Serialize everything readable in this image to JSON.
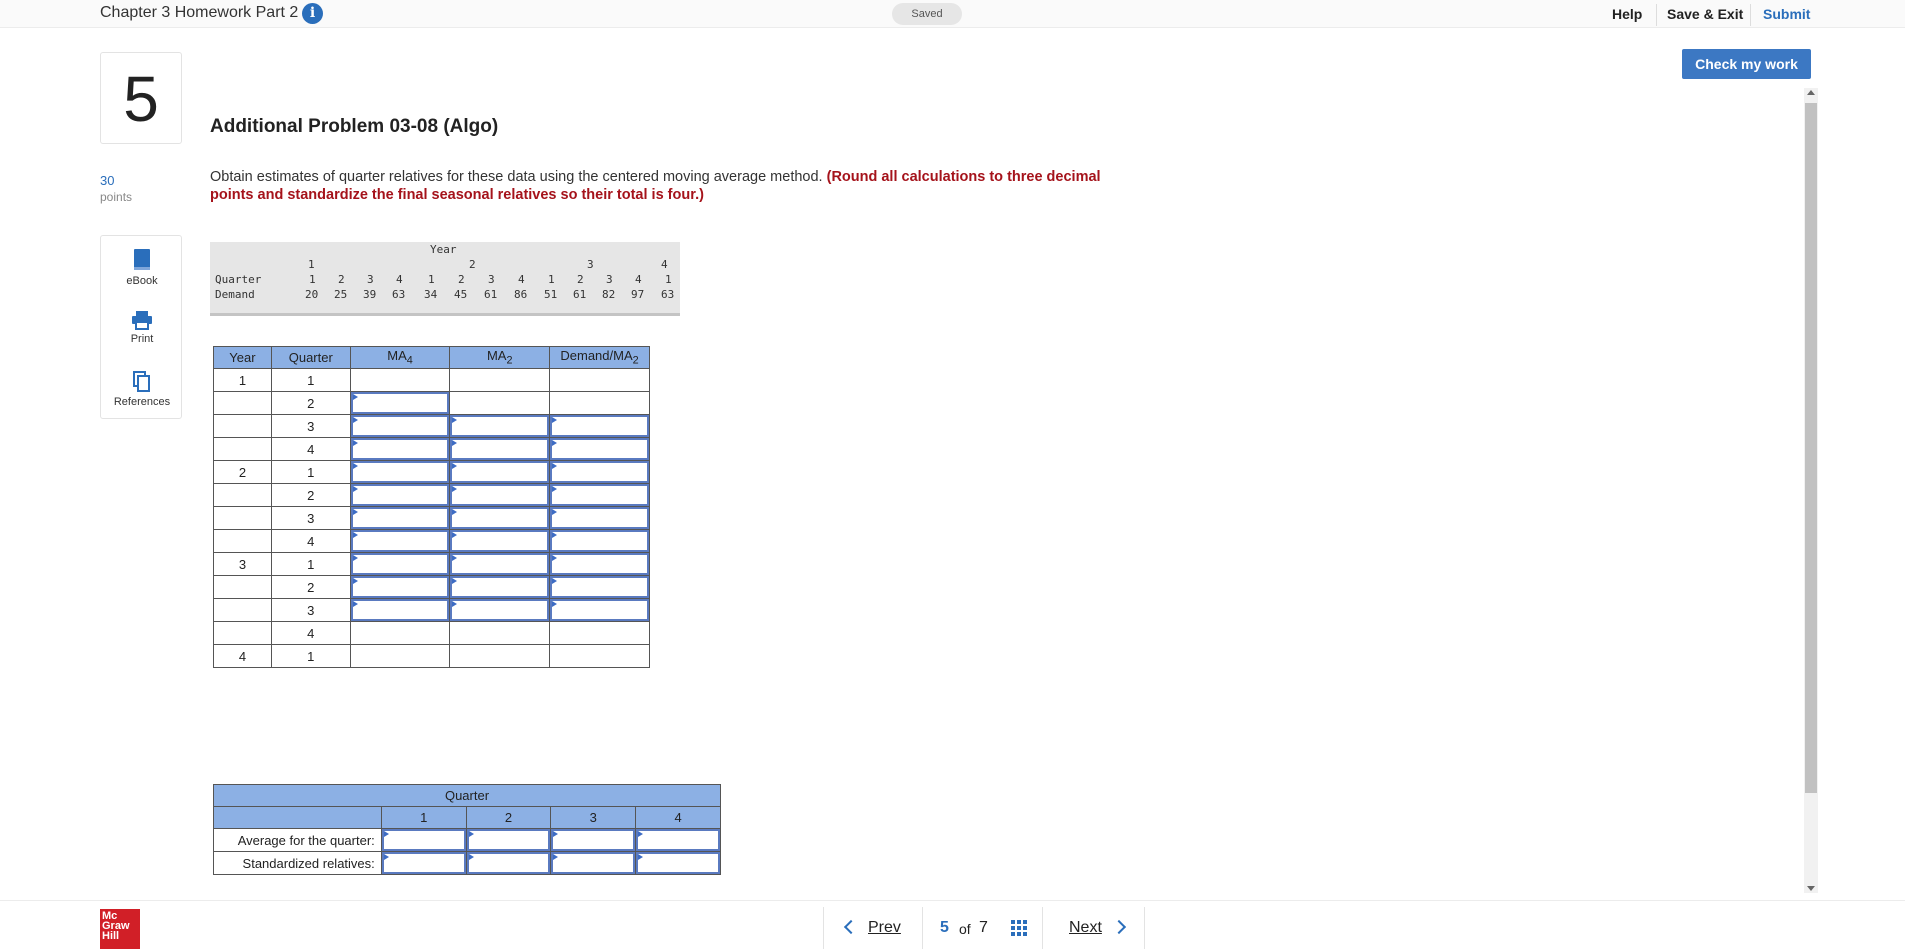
{
  "header": {
    "chapter_title": "Chapter 3 Homework Part 2",
    "saved_status": "Saved",
    "help": "Help",
    "save_exit": "Save & Exit",
    "submit": "Submit",
    "check_my_work": "Check my work"
  },
  "question": {
    "number": "5",
    "points_value": "30",
    "points_label": "points",
    "title": "Additional Problem 03-08 (Algo)",
    "instruction_plain": "Obtain estimates of quarter relatives for these data using the centered moving average method. ",
    "instruction_bold": "(Round all calculations to three decimal points and standardize the final seasonal relatives so their total is four.)"
  },
  "tools": [
    {
      "label": "eBook",
      "icon": "book-icon"
    },
    {
      "label": "Print",
      "icon": "print-icon"
    },
    {
      "label": "References",
      "icon": "references-icon"
    }
  ],
  "data_table": {
    "year_header": "Year",
    "years": [
      "1",
      "2",
      "3",
      "4"
    ],
    "quarter_label": "Quarter",
    "demand_label": "Demand",
    "quarters": [
      "1",
      "2",
      "3",
      "4",
      "1",
      "2",
      "3",
      "4",
      "1",
      "2",
      "3",
      "4",
      "1"
    ],
    "demand": [
      "20",
      "25",
      "39",
      "63",
      "34",
      "45",
      "61",
      "86",
      "51",
      "61",
      "82",
      "97",
      "63"
    ]
  },
  "ma_table": {
    "headers": {
      "year": "Year",
      "quarter": "Quarter",
      "ma4": "MA",
      "ma4_sub": "4",
      "ma2": "MA",
      "ma2_sub": "2",
      "ratio": "Demand/MA",
      "ratio_sub": "2"
    },
    "rows": [
      {
        "year": "1",
        "quarter": "1"
      },
      {
        "year": "",
        "quarter": "2"
      },
      {
        "year": "",
        "quarter": "3"
      },
      {
        "year": "",
        "quarter": "4"
      },
      {
        "year": "2",
        "quarter": "1"
      },
      {
        "year": "",
        "quarter": "2"
      },
      {
        "year": "",
        "quarter": "3"
      },
      {
        "year": "",
        "quarter": "4"
      },
      {
        "year": "3",
        "quarter": "1"
      },
      {
        "year": "",
        "quarter": "2"
      },
      {
        "year": "",
        "quarter": "3"
      },
      {
        "year": "",
        "quarter": "4"
      },
      {
        "year": "4",
        "quarter": "1"
      }
    ]
  },
  "relatives_table": {
    "quarter_header": "Quarter",
    "quarters": [
      "1",
      "2",
      "3",
      "4"
    ],
    "row_labels": [
      "Average for the quarter:",
      "Standardized relatives:"
    ]
  },
  "footer": {
    "logo_lines": [
      "Mc",
      "Graw",
      "Hill"
    ],
    "prev": "Prev",
    "current_page": "5",
    "of_label": "of",
    "total_pages": "7",
    "next": "Next"
  }
}
